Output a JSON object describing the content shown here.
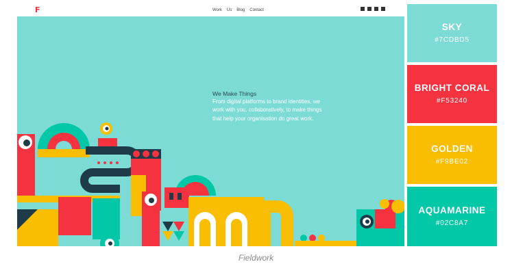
{
  "site": {
    "logo": "F",
    "nav": [
      "Work",
      "Us",
      "Blog",
      "Contact"
    ],
    "social_icons": [
      "twitter-icon",
      "instagram-icon",
      "facebook-icon",
      "mail-icon"
    ],
    "headline": "We Make Things",
    "body_lines": [
      "From digital platforms to brand identities, we",
      "work with you, collaboratively, to make things",
      "that help your organisation do great work."
    ]
  },
  "palette": [
    {
      "name": "SKY",
      "hex": "#7CDBD5",
      "color": "#7CDBD5"
    },
    {
      "name": "BRIGHT CORAL",
      "hex": "#F53240",
      "color": "#F53240"
    },
    {
      "name": "GOLDEN",
      "hex": "#F9BE02",
      "color": "#F9BE02"
    },
    {
      "name": "AQUAMARINE",
      "hex": "#02C8A7",
      "color": "#02C8A7"
    }
  ],
  "caption": "Fieldwork"
}
